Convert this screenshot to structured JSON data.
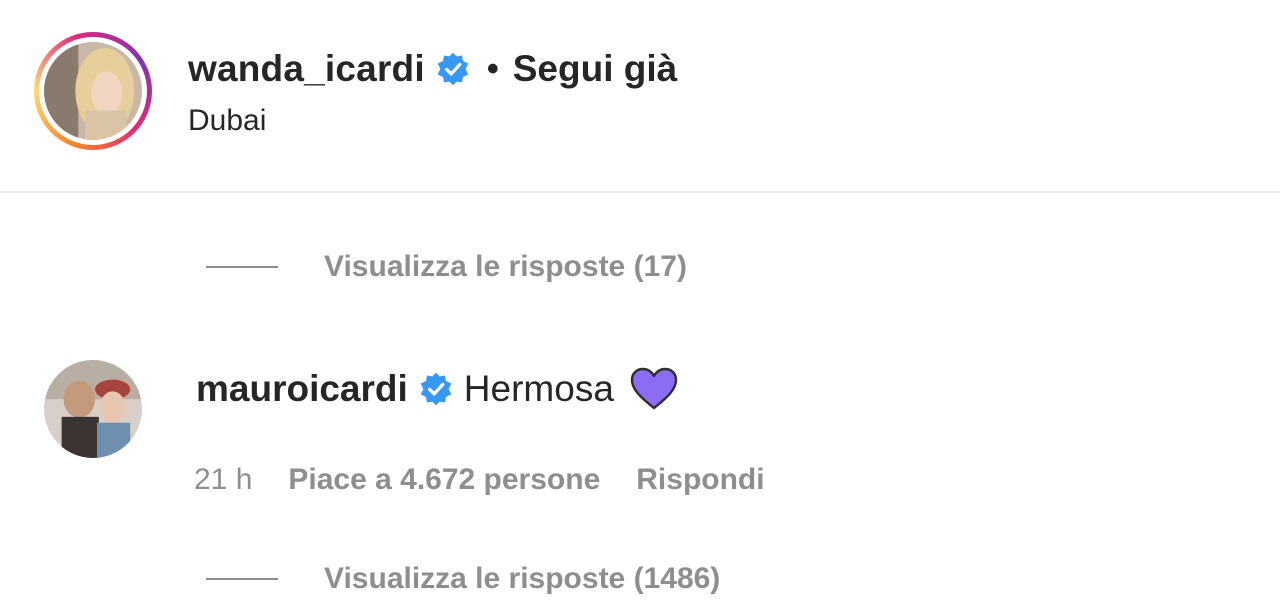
{
  "post_header": {
    "username": "wanda_icardi",
    "separator": "•",
    "follow_status": "Segui già",
    "location": "Dubai"
  },
  "replies_top": {
    "label": "Visualizza le risposte (17)"
  },
  "comment": {
    "username": "mauroicardi",
    "text": "Hermosa",
    "time": "21 h",
    "likes": "Piace a 4.672 persone",
    "reply_label": "Rispondi"
  },
  "replies_bottom": {
    "label": "Visualizza le risposte (1486)"
  },
  "colors": {
    "verified_blue": "#3897f0",
    "heart_purple": "#8c6cf2",
    "muted_text": "#8e8e8e",
    "primary_text": "#262626"
  },
  "icons": [
    "verified-badge-icon",
    "purple-heart-icon"
  ]
}
